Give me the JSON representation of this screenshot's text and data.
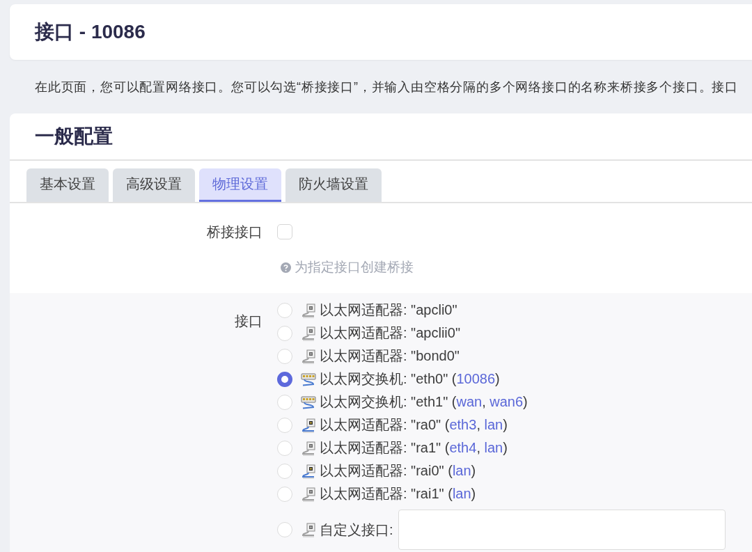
{
  "page_title": "接口 - 10086",
  "description": "在此页面，您可以配置网络接口。您可以勾选“桥接接口”，并输入由空格分隔的多个网络接口的名称来桥接多个接口。接口",
  "section": {
    "title": "一般配置",
    "tabs": [
      {
        "label": "基本设置",
        "selected": false
      },
      {
        "label": "高级设置",
        "selected": false
      },
      {
        "label": "物理设置",
        "selected": true
      },
      {
        "label": "防火墙设置",
        "selected": false
      }
    ],
    "bridge": {
      "label": "桥接接口",
      "checked": false,
      "help": "为指定接口创建桥接"
    },
    "interface": {
      "label": "接口",
      "options": [
        {
          "kind": "adapter",
          "active": false,
          "selected": false,
          "segments": [
            {
              "kind": "text",
              "text": "以太网适配器: \"apcli0\""
            }
          ]
        },
        {
          "kind": "adapter",
          "active": false,
          "selected": false,
          "segments": [
            {
              "kind": "text",
              "text": "以太网适配器: \"apclii0\""
            }
          ]
        },
        {
          "kind": "adapter",
          "active": false,
          "selected": false,
          "segments": [
            {
              "kind": "text",
              "text": "以太网适配器: \"bond0\""
            }
          ]
        },
        {
          "kind": "switch",
          "active": true,
          "selected": true,
          "segments": [
            {
              "kind": "text",
              "text": "以太网交换机: \"eth0\" ("
            },
            {
              "kind": "network",
              "text": "10086"
            },
            {
              "kind": "text",
              "text": ")"
            }
          ]
        },
        {
          "kind": "switch",
          "active": true,
          "selected": false,
          "segments": [
            {
              "kind": "text",
              "text": "以太网交换机: \"eth1\" ("
            },
            {
              "kind": "network",
              "text": "wan"
            },
            {
              "kind": "text",
              "text": ", "
            },
            {
              "kind": "network",
              "text": "wan6"
            },
            {
              "kind": "text",
              "text": ")"
            }
          ]
        },
        {
          "kind": "adapter",
          "active": true,
          "selected": false,
          "segments": [
            {
              "kind": "text",
              "text": "以太网适配器: \"ra0\" ("
            },
            {
              "kind": "network",
              "text": "eth3"
            },
            {
              "kind": "text",
              "text": ", "
            },
            {
              "kind": "network",
              "text": "lan"
            },
            {
              "kind": "text",
              "text": ")"
            }
          ]
        },
        {
          "kind": "adapter",
          "active": false,
          "selected": false,
          "segments": [
            {
              "kind": "text",
              "text": "以太网适配器: \"ra1\" ("
            },
            {
              "kind": "network",
              "text": "eth4"
            },
            {
              "kind": "text",
              "text": ", "
            },
            {
              "kind": "network",
              "text": "lan"
            },
            {
              "kind": "text",
              "text": ")"
            }
          ]
        },
        {
          "kind": "adapter",
          "active": true,
          "selected": false,
          "segments": [
            {
              "kind": "text",
              "text": "以太网适配器: \"rai0\" ("
            },
            {
              "kind": "network",
              "text": "lan"
            },
            {
              "kind": "text",
              "text": ")"
            }
          ]
        },
        {
          "kind": "adapter",
          "active": false,
          "selected": false,
          "segments": [
            {
              "kind": "text",
              "text": "以太网适配器: \"rai1\" ("
            },
            {
              "kind": "network",
              "text": "lan"
            },
            {
              "kind": "text",
              "text": ")"
            }
          ]
        }
      ],
      "custom": {
        "kind": "adapter",
        "active": false,
        "selected": false,
        "label": "自定义接口:"
      }
    }
  }
}
